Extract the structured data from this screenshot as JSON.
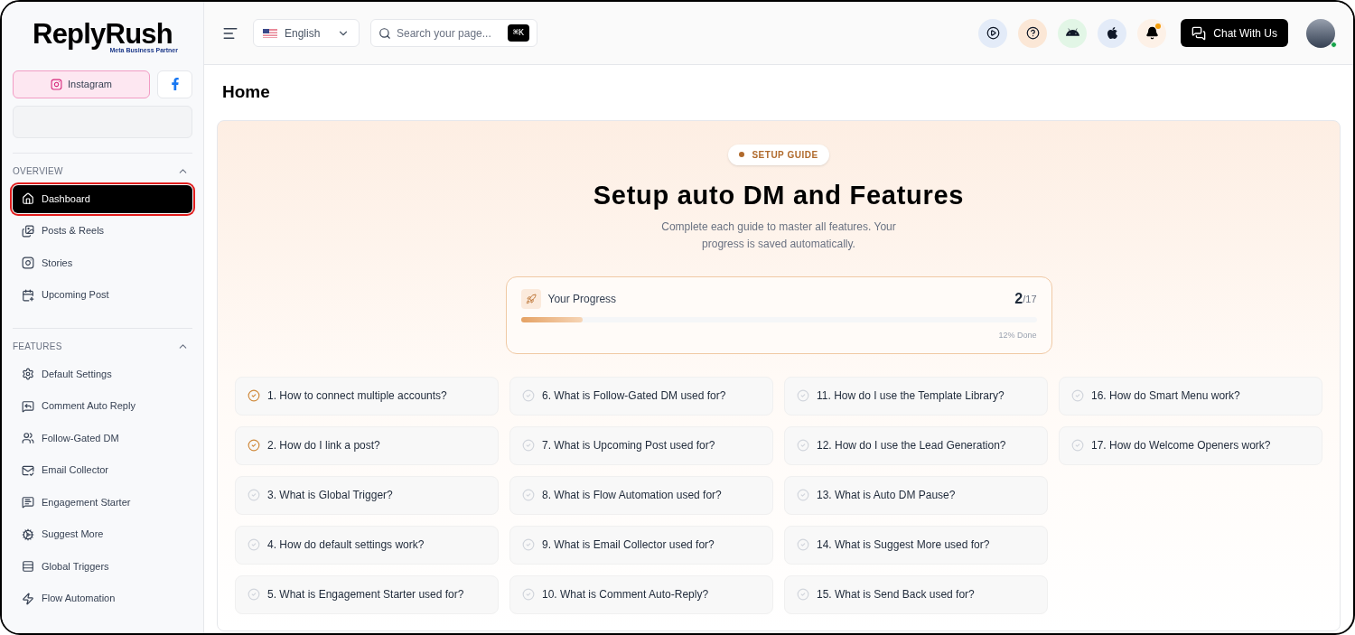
{
  "brand": {
    "name": "ReplyRush",
    "tagline": "Meta Business Partner"
  },
  "platforms": [
    {
      "label": "Instagram",
      "selected": true
    },
    {
      "selected": false
    }
  ],
  "sidebar": {
    "sections": [
      {
        "title": "OVERVIEW",
        "expanded": true,
        "items": [
          {
            "label": "Dashboard",
            "selected": true
          },
          {
            "label": "Posts & Reels",
            "selected": false
          },
          {
            "label": "Stories",
            "selected": false
          },
          {
            "label": "Upcoming Post",
            "selected": false
          }
        ]
      },
      {
        "title": "FEATURES",
        "expanded": true,
        "items": [
          {
            "label": "Default Settings",
            "selected": false
          },
          {
            "label": "Comment Auto Reply",
            "selected": false
          },
          {
            "label": "Follow-Gated DM",
            "selected": false
          },
          {
            "label": "Email Collector",
            "selected": false
          },
          {
            "label": "Engagement Starter",
            "selected": false
          },
          {
            "label": "Suggest More",
            "selected": false
          },
          {
            "label": "Global Triggers",
            "selected": false
          },
          {
            "label": "Flow Automation",
            "selected": false
          }
        ]
      }
    ]
  },
  "header": {
    "language": "English",
    "search": {
      "placeholder": "Search your page...",
      "shortcut": "⌘K"
    },
    "notifications_unread": true,
    "chat_button": "Chat With Us",
    "user_online": true
  },
  "page_title": "Home",
  "guide": {
    "badge": "SETUP GUIDE",
    "title": "Setup auto DM and Features",
    "subtitle": "Complete each guide to master all features. Your progress is saved automatically.",
    "progress": {
      "label": "Your Progress",
      "done": "2",
      "total": "/17",
      "level": 0.12,
      "reading": "12% Done"
    },
    "items": [
      {
        "label": "1. How to connect multiple accounts?",
        "checked": true
      },
      {
        "label": "2. How do I link a post?",
        "checked": true
      },
      {
        "label": "3. What is Global Trigger?",
        "checked": false
      },
      {
        "label": "4. How do default settings work?",
        "checked": false
      },
      {
        "label": "5. What is Engagement Starter used for?",
        "checked": false
      },
      {
        "label": "6. What is Follow-Gated DM used for?",
        "checked": false
      },
      {
        "label": "7. What is Upcoming Post used for?",
        "checked": false
      },
      {
        "label": "8. What is Flow Automation used for?",
        "checked": false
      },
      {
        "label": "9. What is Email Collector used for?",
        "checked": false
      },
      {
        "label": "10. What is Comment Auto-Reply?",
        "checked": false
      },
      {
        "label": "11. How do I use the Template Library?",
        "checked": false
      },
      {
        "label": "12. How do I use the Lead Generation?",
        "checked": false
      },
      {
        "label": "13. What is Auto DM Pause?",
        "checked": false
      },
      {
        "label": "14. What is Suggest More used for?",
        "checked": false
      },
      {
        "label": "15. What is Send Back used for?",
        "checked": false
      },
      {
        "label": "16. How do Smart Menu work?",
        "checked": false
      },
      {
        "label": "17. How do Welcome Openers work?",
        "checked": false
      }
    ]
  }
}
